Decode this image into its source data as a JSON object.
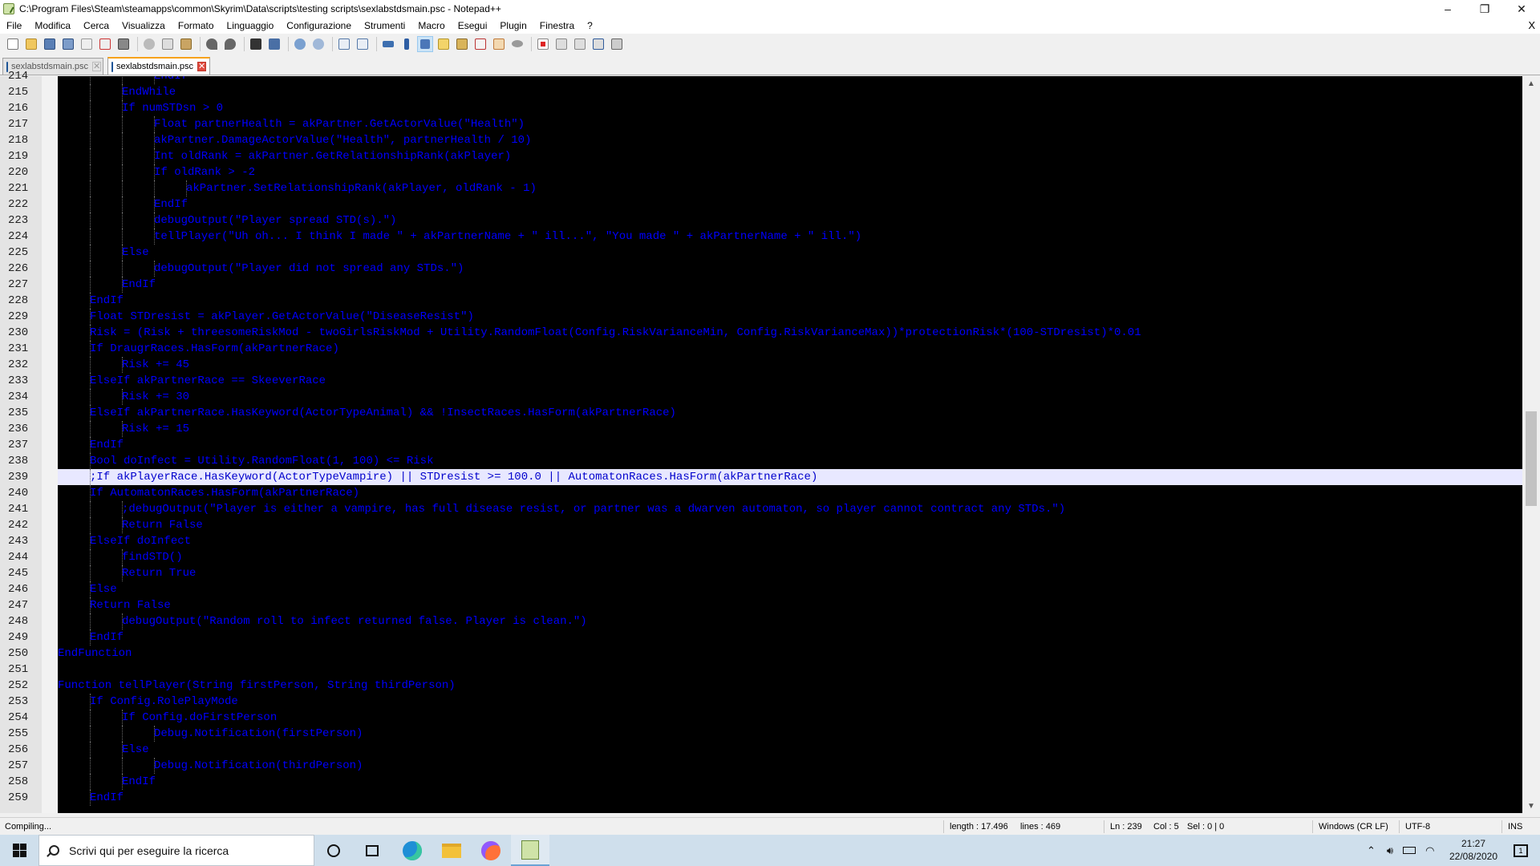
{
  "window": {
    "title": "C:\\Program Files\\Steam\\steamapps\\common\\Skyrim\\Data\\scripts\\testing scripts\\sexlabstdsmain.psc - Notepad++",
    "minimize": "–",
    "maximize": "❐",
    "close": "✕"
  },
  "menu": {
    "items": [
      "File",
      "Modifica",
      "Cerca",
      "Visualizza",
      "Formato",
      "Linguaggio",
      "Configurazione",
      "Strumenti",
      "Macro",
      "Esegui",
      "Plugin",
      "Finestra",
      "?"
    ],
    "close_doc": "X"
  },
  "tabs": [
    {
      "label": "sexlabstdsmain.psc",
      "active": false
    },
    {
      "label": "sexlabstdsmain.psc",
      "active": true
    }
  ],
  "editor": {
    "current_line": 239,
    "lines": [
      {
        "n": "214",
        "indent": 3,
        "text": "EndIf"
      },
      {
        "n": "215",
        "indent": 2,
        "text": "EndWhile"
      },
      {
        "n": "216",
        "indent": 2,
        "text": "If numSTDsn > 0"
      },
      {
        "n": "217",
        "indent": 3,
        "text": "Float partnerHealth = akPartner.GetActorValue(\"Health\")"
      },
      {
        "n": "218",
        "indent": 3,
        "text": "akPartner.DamageActorValue(\"Health\", partnerHealth / 10)"
      },
      {
        "n": "219",
        "indent": 3,
        "text": "Int oldRank = akPartner.GetRelationshipRank(akPlayer)"
      },
      {
        "n": "220",
        "indent": 3,
        "text": "If oldRank > -2"
      },
      {
        "n": "221",
        "indent": 4,
        "text": "akPartner.SetRelationshipRank(akPlayer, oldRank - 1)"
      },
      {
        "n": "222",
        "indent": 3,
        "text": "EndIf"
      },
      {
        "n": "223",
        "indent": 3,
        "text": "debugOutput(\"Player spread STD(s).\")"
      },
      {
        "n": "224",
        "indent": 3,
        "text": "tellPlayer(\"Uh oh... I think I made \" + akPartnerName + \" ill...\", \"You made \" + akPartnerName + \" ill.\")"
      },
      {
        "n": "225",
        "indent": 2,
        "text": "Else"
      },
      {
        "n": "226",
        "indent": 3,
        "text": "debugOutput(\"Player did not spread any STDs.\")"
      },
      {
        "n": "227",
        "indent": 2,
        "text": "EndIf"
      },
      {
        "n": "228",
        "indent": 1,
        "text": "EndIf"
      },
      {
        "n": "229",
        "indent": 1,
        "text": "Float STDresist = akPlayer.GetActorValue(\"DiseaseResist\")"
      },
      {
        "n": "230",
        "indent": 1,
        "text": "Risk = (Risk + threesomeRiskMod - twoGirlsRiskMod + Utility.RandomFloat(Config.RiskVarianceMin, Config.RiskVarianceMax))*protectionRisk*(100-STDresist)*0.01"
      },
      {
        "n": "231",
        "indent": 1,
        "text": "If DraugrRaces.HasForm(akPartnerRace)"
      },
      {
        "n": "232",
        "indent": 2,
        "text": "Risk += 45"
      },
      {
        "n": "233",
        "indent": 1,
        "text": "ElseIf akPartnerRace == SkeeverRace"
      },
      {
        "n": "234",
        "indent": 2,
        "text": "Risk += 30"
      },
      {
        "n": "235",
        "indent": 1,
        "text": "ElseIf akPartnerRace.HasKeyword(ActorTypeAnimal) && !InsectRaces.HasForm(akPartnerRace)"
      },
      {
        "n": "236",
        "indent": 2,
        "text": "Risk += 15"
      },
      {
        "n": "237",
        "indent": 1,
        "text": "EndIf"
      },
      {
        "n": "238",
        "indent": 1,
        "text": "Bool doInfect = Utility.RandomFloat(1, 100) <= Risk"
      },
      {
        "n": "239",
        "indent": 1,
        "text": ";If akPlayerRace.HasKeyword(ActorTypeVampire) || STDresist >= 100.0 || AutomatonRaces.HasForm(akPartnerRace)"
      },
      {
        "n": "240",
        "indent": 1,
        "text": "If AutomatonRaces.HasForm(akPartnerRace)"
      },
      {
        "n": "241",
        "indent": 2,
        "text": ";debugOutput(\"Player is either a vampire, has full disease resist, or partner was a dwarven automaton, so player cannot contract any STDs.\")"
      },
      {
        "n": "242",
        "indent": 2,
        "text": "Return False"
      },
      {
        "n": "243",
        "indent": 1,
        "text": "ElseIf doInfect"
      },
      {
        "n": "244",
        "indent": 2,
        "text": "findSTD()"
      },
      {
        "n": "245",
        "indent": 2,
        "text": "Return True"
      },
      {
        "n": "246",
        "indent": 1,
        "text": "Else"
      },
      {
        "n": "247",
        "indent": 1,
        "text": "Return False"
      },
      {
        "n": "248",
        "indent": 2,
        "text": "debugOutput(\"Random roll to infect returned false. Player is clean.\")"
      },
      {
        "n": "249",
        "indent": 1,
        "text": "EndIf"
      },
      {
        "n": "250",
        "indent": 0,
        "text": "EndFunction"
      },
      {
        "n": "251",
        "indent": 0,
        "text": ""
      },
      {
        "n": "252",
        "indent": 0,
        "text": "Function tellPlayer(String firstPerson, String thirdPerson)"
      },
      {
        "n": "253",
        "indent": 1,
        "text": "If Config.RolePlayMode"
      },
      {
        "n": "254",
        "indent": 2,
        "text": "If Config.doFirstPerson"
      },
      {
        "n": "255",
        "indent": 3,
        "text": "Debug.Notification(firstPerson)"
      },
      {
        "n": "256",
        "indent": 2,
        "text": "Else"
      },
      {
        "n": "257",
        "indent": 3,
        "text": "Debug.Notification(thirdPerson)"
      },
      {
        "n": "258",
        "indent": 2,
        "text": "EndIf"
      },
      {
        "n": "259",
        "indent": 1,
        "text": "EndIf"
      }
    ]
  },
  "statusbar": {
    "message": "Compiling...",
    "length": "length : 17.496",
    "lines": "lines : 469",
    "ln": "Ln : 239",
    "col": "Col : 5",
    "sel": "Sel : 0 | 0",
    "eol": "Windows (CR LF)",
    "encoding": "UTF-8",
    "mode": "INS"
  },
  "taskbar": {
    "search_placeholder": "Scrivi qui per eseguire la ricerca",
    "time": "21:27",
    "date": "22/08/2020",
    "notification_count": "1"
  },
  "colors": {
    "code_text": "#0000ff",
    "editor_bg": "#000000",
    "current_line_bg": "#e8e8ff",
    "active_tab_accent": "#f7a21b"
  }
}
